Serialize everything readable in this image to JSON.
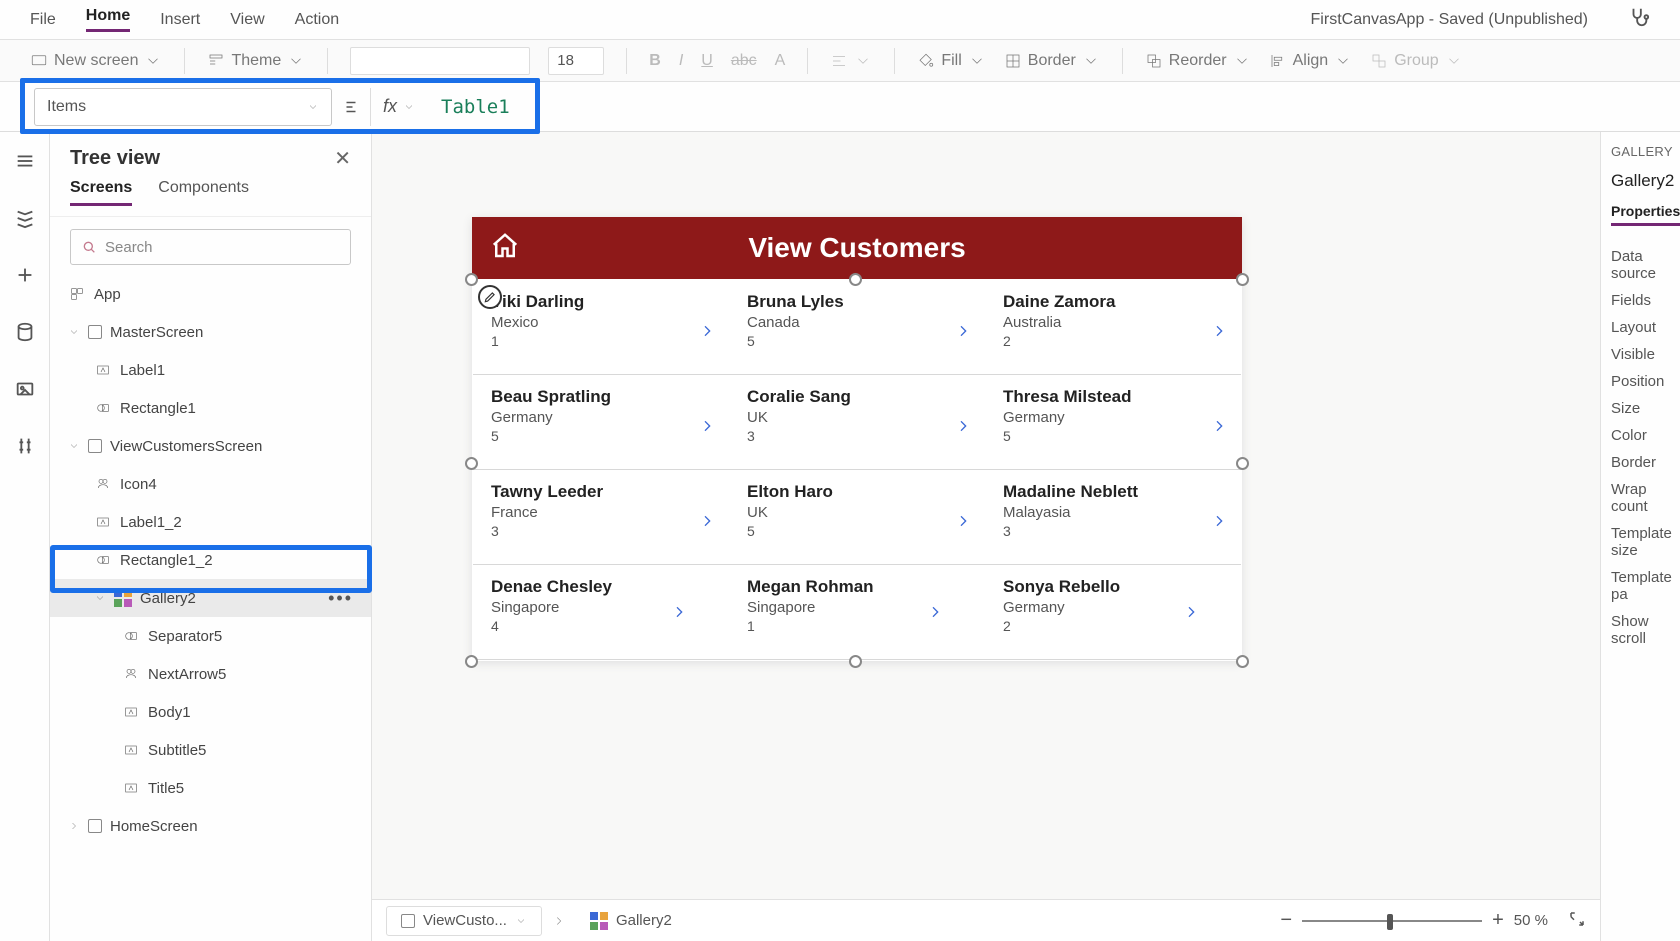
{
  "menubar": {
    "file": "File",
    "home": "Home",
    "insert": "Insert",
    "view": "View",
    "action": "Action",
    "app_title": "FirstCanvasApp - Saved (Unpublished)"
  },
  "ribbon": {
    "new_screen": "New screen",
    "theme": "Theme",
    "font_size": "18",
    "fill": "Fill",
    "border": "Border",
    "reorder": "Reorder",
    "align": "Align",
    "group": "Group"
  },
  "formula_bar": {
    "property": "Items",
    "value": "Table1"
  },
  "treeview": {
    "title": "Tree view",
    "tabs": {
      "screens": "Screens",
      "components": "Components"
    },
    "search_placeholder": "Search",
    "nodes": {
      "app": "App",
      "master": "MasterScreen",
      "label1": "Label1",
      "rect1": "Rectangle1",
      "viewcust": "ViewCustomersScreen",
      "icon4": "Icon4",
      "label1_2": "Label1_2",
      "rect1_2": "Rectangle1_2",
      "gallery2": "Gallery2",
      "separator5": "Separator5",
      "nextarrow5": "NextArrow5",
      "body1": "Body1",
      "subtitle5": "Subtitle5",
      "title5": "Title5",
      "homescreen": "HomeScreen"
    }
  },
  "canvas": {
    "header": "View Customers",
    "records": [
      {
        "name": "Viki  Darling",
        "country": "Mexico",
        "num": "1"
      },
      {
        "name": "Bruna  Lyles",
        "country": "Canada",
        "num": "5"
      },
      {
        "name": "Daine  Zamora",
        "country": "Australia",
        "num": "2"
      },
      {
        "name": "Beau  Spratling",
        "country": "Germany",
        "num": "5"
      },
      {
        "name": "Coralie  Sang",
        "country": "UK",
        "num": "3"
      },
      {
        "name": "Thresa  Milstead",
        "country": "Germany",
        "num": "5"
      },
      {
        "name": "Tawny  Leeder",
        "country": "France",
        "num": "3"
      },
      {
        "name": "Elton  Haro",
        "country": "UK",
        "num": "5"
      },
      {
        "name": "Madaline  Neblett",
        "country": "Malayasia",
        "num": "3"
      },
      {
        "name": "Denae  Chesley",
        "country": "Singapore",
        "num": "4"
      },
      {
        "name": "Megan  Rohman",
        "country": "Singapore",
        "num": "1"
      },
      {
        "name": "Sonya  Rebello",
        "country": "Germany",
        "num": "2"
      }
    ]
  },
  "statusbar": {
    "crumb1": "ViewCusto...",
    "crumb2": "Gallery2",
    "zoom": "50  %"
  },
  "props": {
    "label": "GALLERY",
    "name": "Gallery2",
    "tab": "Properties",
    "rows": [
      "Data source",
      "Fields",
      "Layout",
      "Visible",
      "Position",
      "Size",
      "Color",
      "Border",
      "Wrap count",
      "Template size",
      "Template pa",
      "Show scroll"
    ]
  }
}
